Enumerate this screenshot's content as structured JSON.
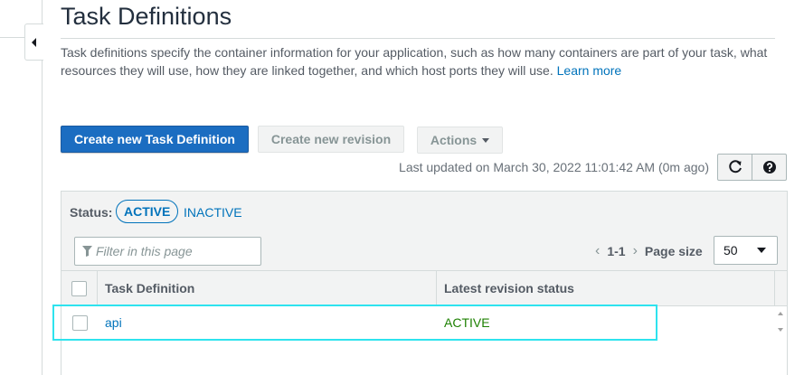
{
  "page": {
    "title": "Task Definitions",
    "description": "Task definitions specify the container information for your application, such as how many containers are part of your task, what resources they will use, how they are linked together, and which host ports they will use.",
    "learn_more": "Learn more"
  },
  "toolbar": {
    "create_label": "Create new Task Definition",
    "revision_label": "Create new revision",
    "actions_label": "Actions",
    "last_updated": "Last updated on March 30, 2022 11:01:42 AM (0m ago)",
    "refresh_icon": "refresh-icon",
    "help_icon": "help-icon"
  },
  "filter": {
    "status_label": "Status:",
    "active_label": "ACTIVE",
    "inactive_label": "INACTIVE",
    "placeholder": "Filter in this page"
  },
  "pagination": {
    "range": "1-1",
    "page_size_label": "Page size",
    "page_size": "50"
  },
  "table": {
    "columns": [
      "Task Definition",
      "Latest revision status"
    ],
    "rows": [
      {
        "name": "api",
        "status": "ACTIVE"
      }
    ]
  },
  "colors": {
    "primary": "#1b6dc1",
    "link": "#0073bb",
    "active_status": "#1d8102",
    "highlight": "#2ee3ee"
  }
}
